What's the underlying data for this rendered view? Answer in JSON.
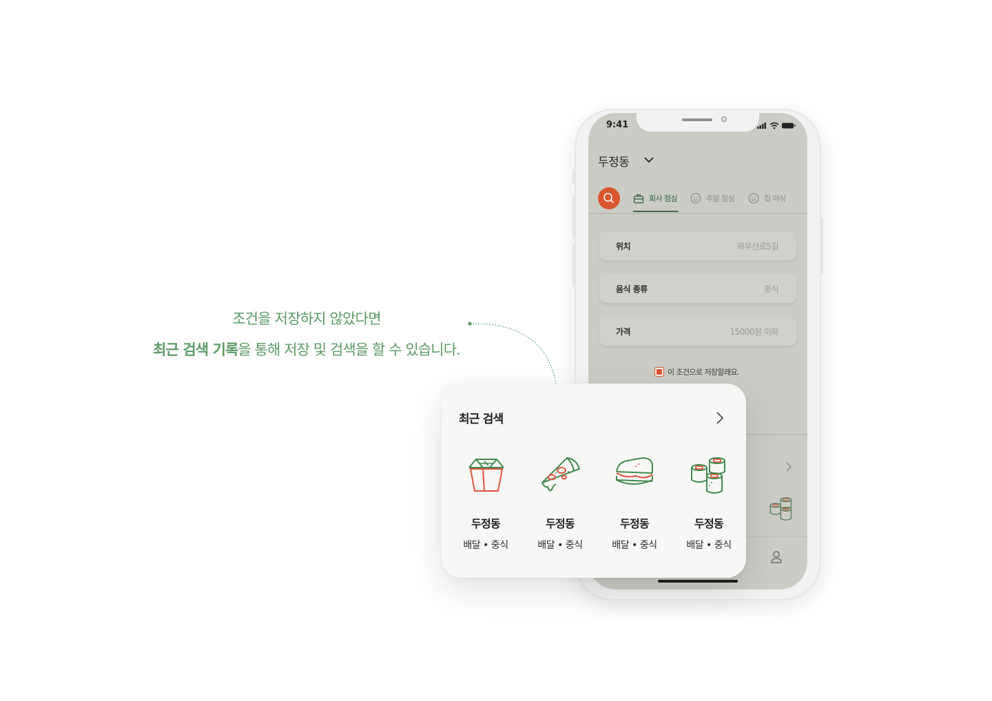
{
  "caption": {
    "line1": "조건을 저장하지 않았다면",
    "line2_bold": "최근 검색 기록",
    "line2_rest": "을 통해 저장 및 검색을 할 수 있습니다."
  },
  "phone": {
    "status_time": "9:41",
    "location": "두정동",
    "tabs": [
      {
        "label": "회사 점심",
        "icon": "briefcase-icon",
        "active": true
      },
      {
        "label": "주말 점심",
        "icon": "smile-icon",
        "active": false
      },
      {
        "label": "집 야식",
        "icon": "smile-icon",
        "active": false
      }
    ],
    "fields": [
      {
        "label": "위치",
        "value": "와우산로5길"
      },
      {
        "label": "음식 종류",
        "value": "중식"
      },
      {
        "label": "가격",
        "value": "15000원 이하"
      }
    ],
    "save_label": "이 조건으로 저장할래요."
  },
  "recent": {
    "title": "최근 검색",
    "items": [
      {
        "name": "두정동",
        "sub": "배달 • 중식",
        "icon": "takeout-box-icon"
      },
      {
        "name": "두정동",
        "sub": "배달 • 중식",
        "icon": "pizza-icon"
      },
      {
        "name": "두정동",
        "sub": "배달 • 중식",
        "icon": "sandwich-icon"
      },
      {
        "name": "두정동",
        "sub": "배달 • 중식",
        "icon": "sushi-icon"
      }
    ]
  },
  "colors": {
    "accent_green": "#5a9a64",
    "accent_orange": "#d9562f",
    "icon_green": "#3f8a4e",
    "icon_red": "#e0533a"
  }
}
